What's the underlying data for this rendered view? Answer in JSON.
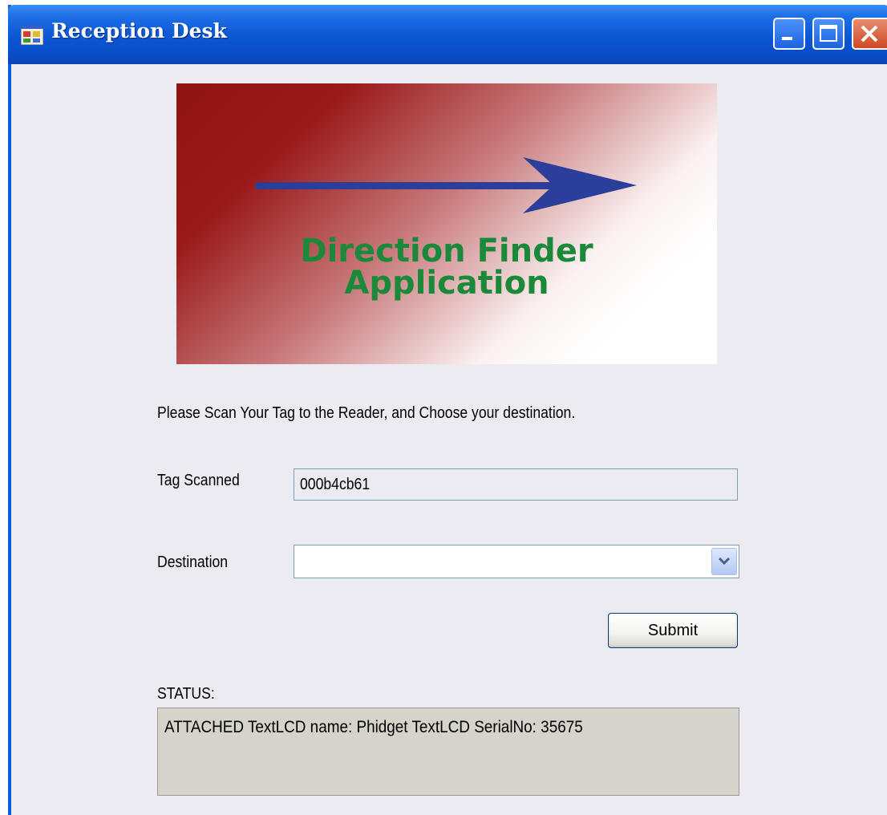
{
  "window": {
    "title": "Reception Desk",
    "app_icon": "app-window-icon",
    "controls": [
      "minimize-icon",
      "maximize-icon",
      "close-icon"
    ],
    "title_bar_color": "#0a56d4"
  },
  "banner": {
    "title_line1": "Direction Finder",
    "title_line2": "Application",
    "arrow_icon": "arrow-right-icon",
    "text_color": "#1a8a3a",
    "arrow_color": "#2a3e9a",
    "gradient_start": "#8f1212",
    "gradient_end": "#ffffff"
  },
  "form": {
    "instructions": "Please Scan Your Tag to the Reader, and Choose your destination.",
    "tag_label": "Tag Scanned",
    "tag_value": "000b4cb61",
    "destination_label": "Destination",
    "destination_value": "",
    "dropdown_icon": "chevron-down-icon",
    "submit_label": "Submit"
  },
  "status": {
    "label": "STATUS:",
    "message": "ATTACHED TextLCD name: Phidget TextLCD SerialNo: 35675"
  }
}
